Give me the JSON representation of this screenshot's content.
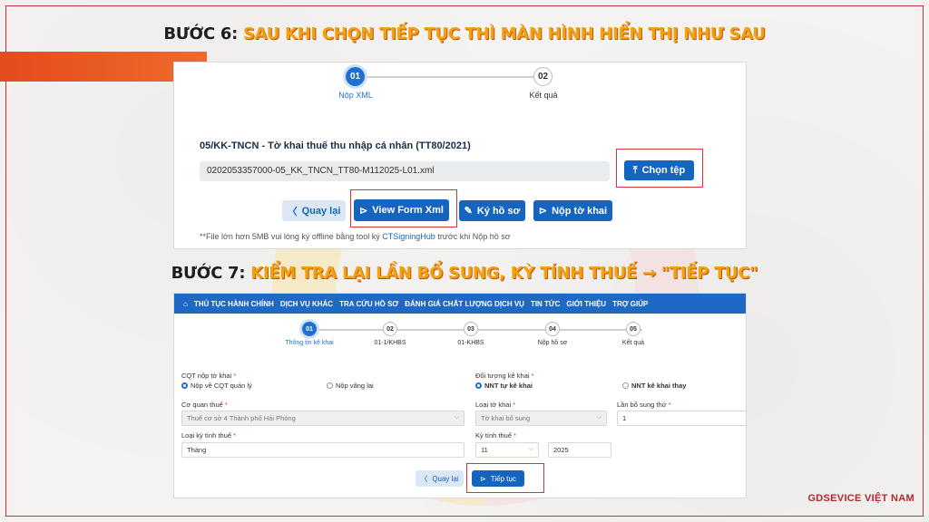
{
  "step6": {
    "key": "BƯỚC 6:",
    "text": "SAU KHI CHỌN TIẾP TỤC THÌ MÀN HÌNH HIỂN THỊ NHƯ SAU"
  },
  "step7": {
    "key": "BƯỚC 7:",
    "text": "KIỂM TRA LẠI LẦN BỔ SUNG, KỲ TÍNH THUẾ → \"TIẾP TỤC\""
  },
  "panel1": {
    "steps": [
      {
        "num": "01",
        "label": "Nộp XML"
      },
      {
        "num": "02",
        "label": "Kết quả"
      }
    ],
    "form_title": "05/KK-TNCN - Tờ khai thuế thu nhập cá nhân (TT80/2021)",
    "file_name": "0202053357000-05_KK_TNCN_TT80-M112025-L01.xml",
    "choose_file": "Chọn tệp",
    "back": "Quay lại",
    "view_form": "View Form Xml",
    "sign": "Ký hồ sơ",
    "submit": "Nộp tờ khai",
    "note_pre": "**File lớn hơn 5MB vui lòng ký offline bằng tool ký",
    "note_link": "CTSigningHub",
    "note_post": "trước khi Nộp hồ sơ"
  },
  "panel2": {
    "nav": [
      "THỦ TỤC HÀNH CHÍNH",
      "DỊCH VỤ KHÁC",
      "TRA CỨU HỒ SƠ",
      "ĐÁNH GIÁ CHẤT LƯỢNG DỊCH VỤ",
      "TIN TỨC",
      "GIỚI THIỆU",
      "TRỢ GIÚP"
    ],
    "steps": [
      {
        "num": "01",
        "label": "Thông tin kê khai"
      },
      {
        "num": "02",
        "label": "01-1/KHBS"
      },
      {
        "num": "03",
        "label": "01-KHBS"
      },
      {
        "num": "04",
        "label": "Nộp hồ sơ"
      },
      {
        "num": "05",
        "label": "Kết quả"
      }
    ],
    "cqt_label": "CQT nộp tờ khai",
    "cqt_opt1": "Nộp về CQT quản lý",
    "cqt_opt2": "Nộp vãng lai",
    "doituong_label": "Đối tượng kê khai",
    "doituong_opt1": "NNT tự kê khai",
    "doituong_opt2": "NNT kê khai thay",
    "coquan_label": "Cơ quan thuế",
    "coquan_value": "Thuế cơ sở 4 Thành phố Hải Phòng",
    "loaitk_label": "Loại tờ khai",
    "loaitk_value": "Tờ khai bổ sung",
    "lanbs_label": "Lần bổ sung thứ",
    "lanbs_value": "1",
    "loaiky_label": "Loại kỳ tính thuế",
    "loaiky_value": "Tháng",
    "kytt_label": "Kỳ tính thuế",
    "kytt_month": "11",
    "kytt_year": "2025",
    "back": "Quay lại",
    "next": "Tiếp tục"
  },
  "brand": "GDSEVICE VIỆT NAM"
}
